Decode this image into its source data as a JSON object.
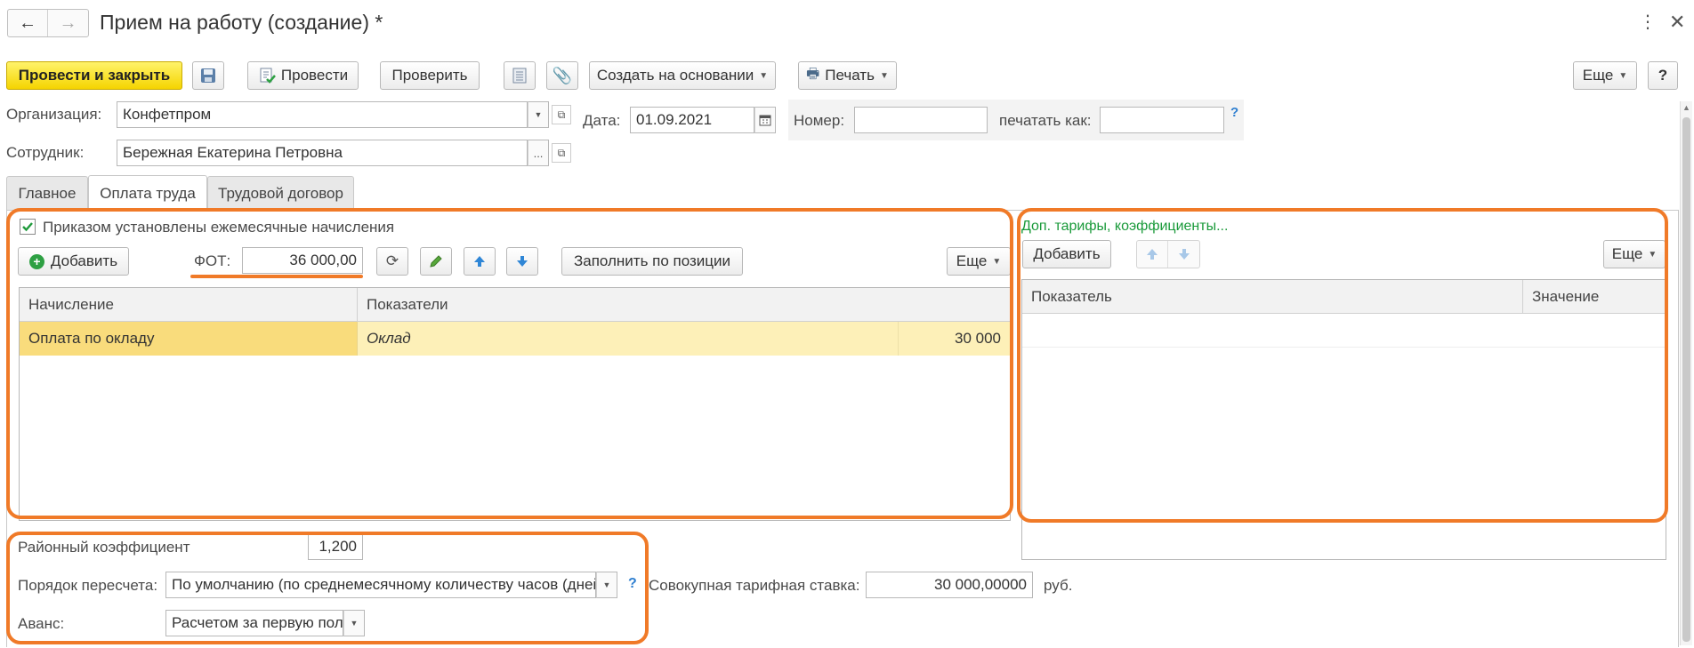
{
  "window": {
    "title": "Прием на работу (создание) *"
  },
  "toolbar": {
    "post_close_label": "Провести и закрыть",
    "post_label": "Провести",
    "check_label": "Проверить",
    "create_based_label": "Создать на основании",
    "print_label": "Печать",
    "more_label": "Еще",
    "help_label": "?"
  },
  "header": {
    "org_label": "Организация:",
    "org_value": "Конфетпром",
    "employee_label": "Сотрудник:",
    "employee_value": "Бережная Екатерина Петровна",
    "employee_choose": "...",
    "date_label": "Дата:",
    "date_value": "01.09.2021",
    "number_label": "Номер:",
    "number_value": "",
    "print_as_label": "печатать как:",
    "print_as_value": "",
    "help_mark": "?"
  },
  "tabs": [
    {
      "label": "Главное"
    },
    {
      "label": "Оплата труда"
    },
    {
      "label": "Трудовой договор"
    }
  ],
  "accruals": {
    "checkbox_label": "Приказом установлены ежемесячные начисления",
    "checked": true,
    "add_label": "Добавить",
    "fot_label": "ФОТ:",
    "fot_value": "36 000,00",
    "fill_label": "Заполнить по позиции",
    "more_label": "Еще",
    "columns": [
      "Начисление",
      "Показатели"
    ],
    "rows": [
      {
        "accrual": "Оплата по окладу",
        "indicator": "Оклад",
        "value": "30 000"
      }
    ]
  },
  "tariffs": {
    "title": "Доп. тарифы, коэффициенты...",
    "add_label": "Добавить",
    "more_label": "Еще",
    "columns": [
      "Показатель",
      "Значение"
    ]
  },
  "bottom": {
    "district_coef_label": "Районный коэффициент",
    "district_coef_value": "1,200",
    "recalc_label": "Порядок пересчета:",
    "recalc_value": "По умолчанию (по среднемесячному количеству часов (дней))",
    "recalc_help": "?",
    "total_rate_label": "Совокупная тарифная ставка:",
    "total_rate_value": "30 000,00000",
    "total_rate_unit": "руб.",
    "advance_label": "Аванс:",
    "advance_value": "Расчетом за первую половину месяца"
  },
  "colors": {
    "primary_button": "#f5d400",
    "highlight": "#f07a28",
    "selected_row": "#fdf0b8",
    "green_link": "#1a9a3a"
  }
}
